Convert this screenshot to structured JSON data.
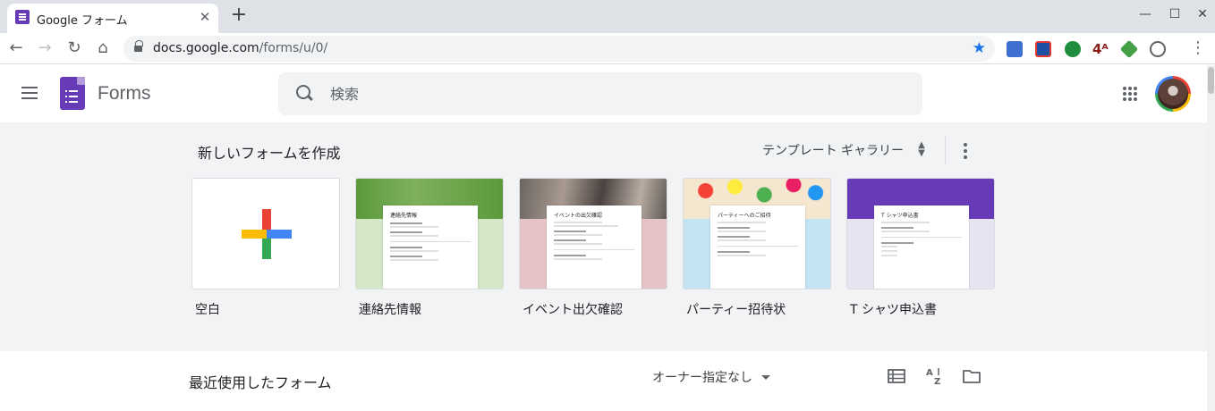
{
  "browser": {
    "tab_title": "Google フォーム",
    "tab_close": "✕",
    "new_tab": "+",
    "url_host": "docs.google.com",
    "url_path": "/forms/u/0/",
    "window_controls": {
      "minimize": "—",
      "maximize": "☐",
      "close": "✕"
    }
  },
  "header": {
    "app_name": "Forms",
    "search_placeholder": "検索"
  },
  "templates": {
    "section_title": "新しいフォームを作成",
    "gallery_label": "テンプレート ギャラリー",
    "items": [
      {
        "label": "空白"
      },
      {
        "label": "連絡先情報",
        "doc_title": "連絡先情報"
      },
      {
        "label": "イベント出欠確認",
        "doc_title": "イベントの出欠確認"
      },
      {
        "label": "パーティー招待状",
        "doc_title": "パーティーへのご招待"
      },
      {
        "label": "T シャツ申込書",
        "doc_title": "T シャツ申込書"
      }
    ]
  },
  "recent": {
    "section_title": "最近使用したフォーム",
    "owner_filter": "オーナー指定なし"
  },
  "colors": {
    "forms_purple": "#673ab7",
    "google_red": "#ea4335",
    "google_yellow": "#fbbc04",
    "google_green": "#34a853",
    "google_blue": "#4285f4",
    "star_blue": "#1a73e8"
  },
  "icons": [
    "hamburger-menu-icon",
    "forms-logo-icon",
    "search-icon",
    "apps-grid-icon",
    "unfold-more-icon",
    "more-vert-icon",
    "list-view-icon",
    "sort-az-icon",
    "folder-icon",
    "back-icon",
    "forward-icon",
    "reload-icon",
    "home-icon",
    "lock-icon",
    "bookmark-star-icon"
  ]
}
